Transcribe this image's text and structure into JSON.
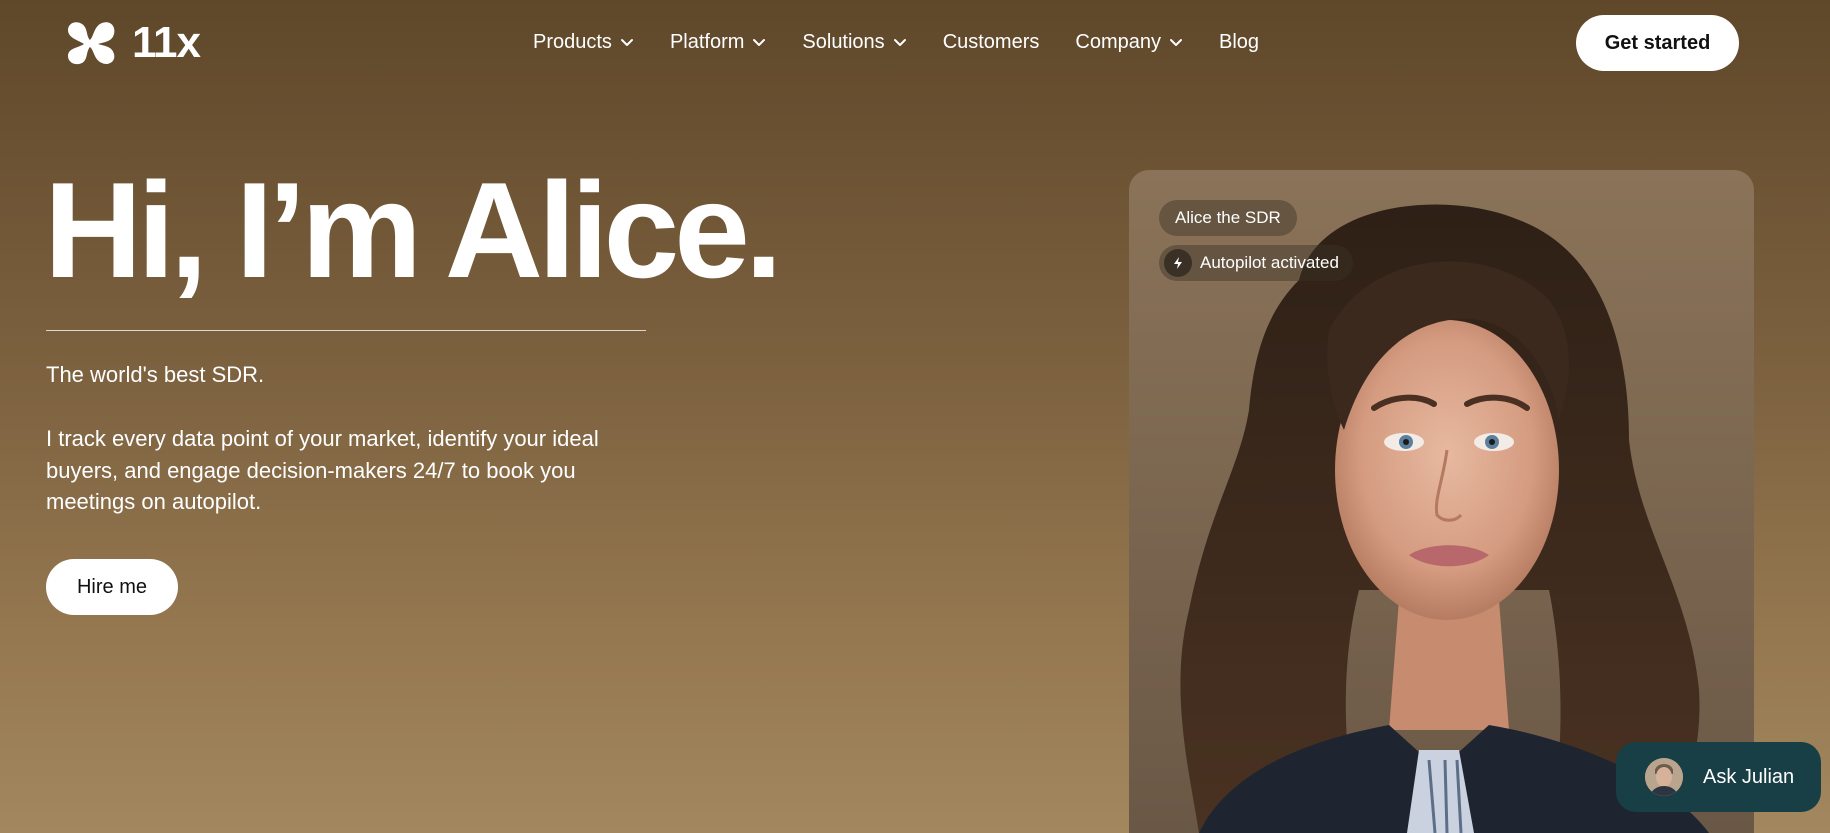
{
  "brand": {
    "name": "11x"
  },
  "nav": {
    "items": [
      {
        "label": "Products",
        "dropdown": true
      },
      {
        "label": "Platform",
        "dropdown": true
      },
      {
        "label": "Solutions",
        "dropdown": true
      },
      {
        "label": "Customers",
        "dropdown": false
      },
      {
        "label": "Company",
        "dropdown": true
      },
      {
        "label": "Blog",
        "dropdown": false
      }
    ],
    "cta_label": "Get started"
  },
  "hero": {
    "title": "Hi, I’m Alice.",
    "tagline": "The world's best SDR.",
    "description": "I track every data point of your market, identify your ideal buyers, and engage decision-makers 24/7 to book you meetings on autopilot.",
    "button_label": "Hire me"
  },
  "card": {
    "name_badge": "Alice the SDR",
    "status_badge": "Autopilot activated",
    "status_icon": "bolt-icon"
  },
  "chat": {
    "label": "Ask Julian"
  },
  "colors": {
    "accent": "#ffffff",
    "chat_bg": "#173f45",
    "background": "#7d6240"
  }
}
